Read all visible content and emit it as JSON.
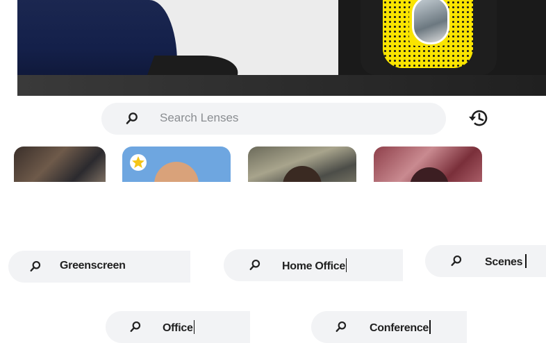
{
  "search": {
    "placeholder": "Search Lenses"
  },
  "icons": {
    "search": "search-icon",
    "history": "history-icon",
    "favorite": "star-icon"
  },
  "colors": {
    "snapcode": "#f9e400",
    "chip_bg": "#f2f3f5",
    "placeholder": "#8a8d91"
  },
  "lens_tiles": [
    {
      "name": "lens-1"
    },
    {
      "name": "lens-2",
      "favorite": true
    },
    {
      "name": "lens-3"
    },
    {
      "name": "lens-4"
    }
  ],
  "search_chips": [
    {
      "text": "Greenscreen"
    },
    {
      "text": "Home Office"
    },
    {
      "text": "Scenes"
    },
    {
      "text": "Office"
    },
    {
      "text": "Conference"
    }
  ]
}
